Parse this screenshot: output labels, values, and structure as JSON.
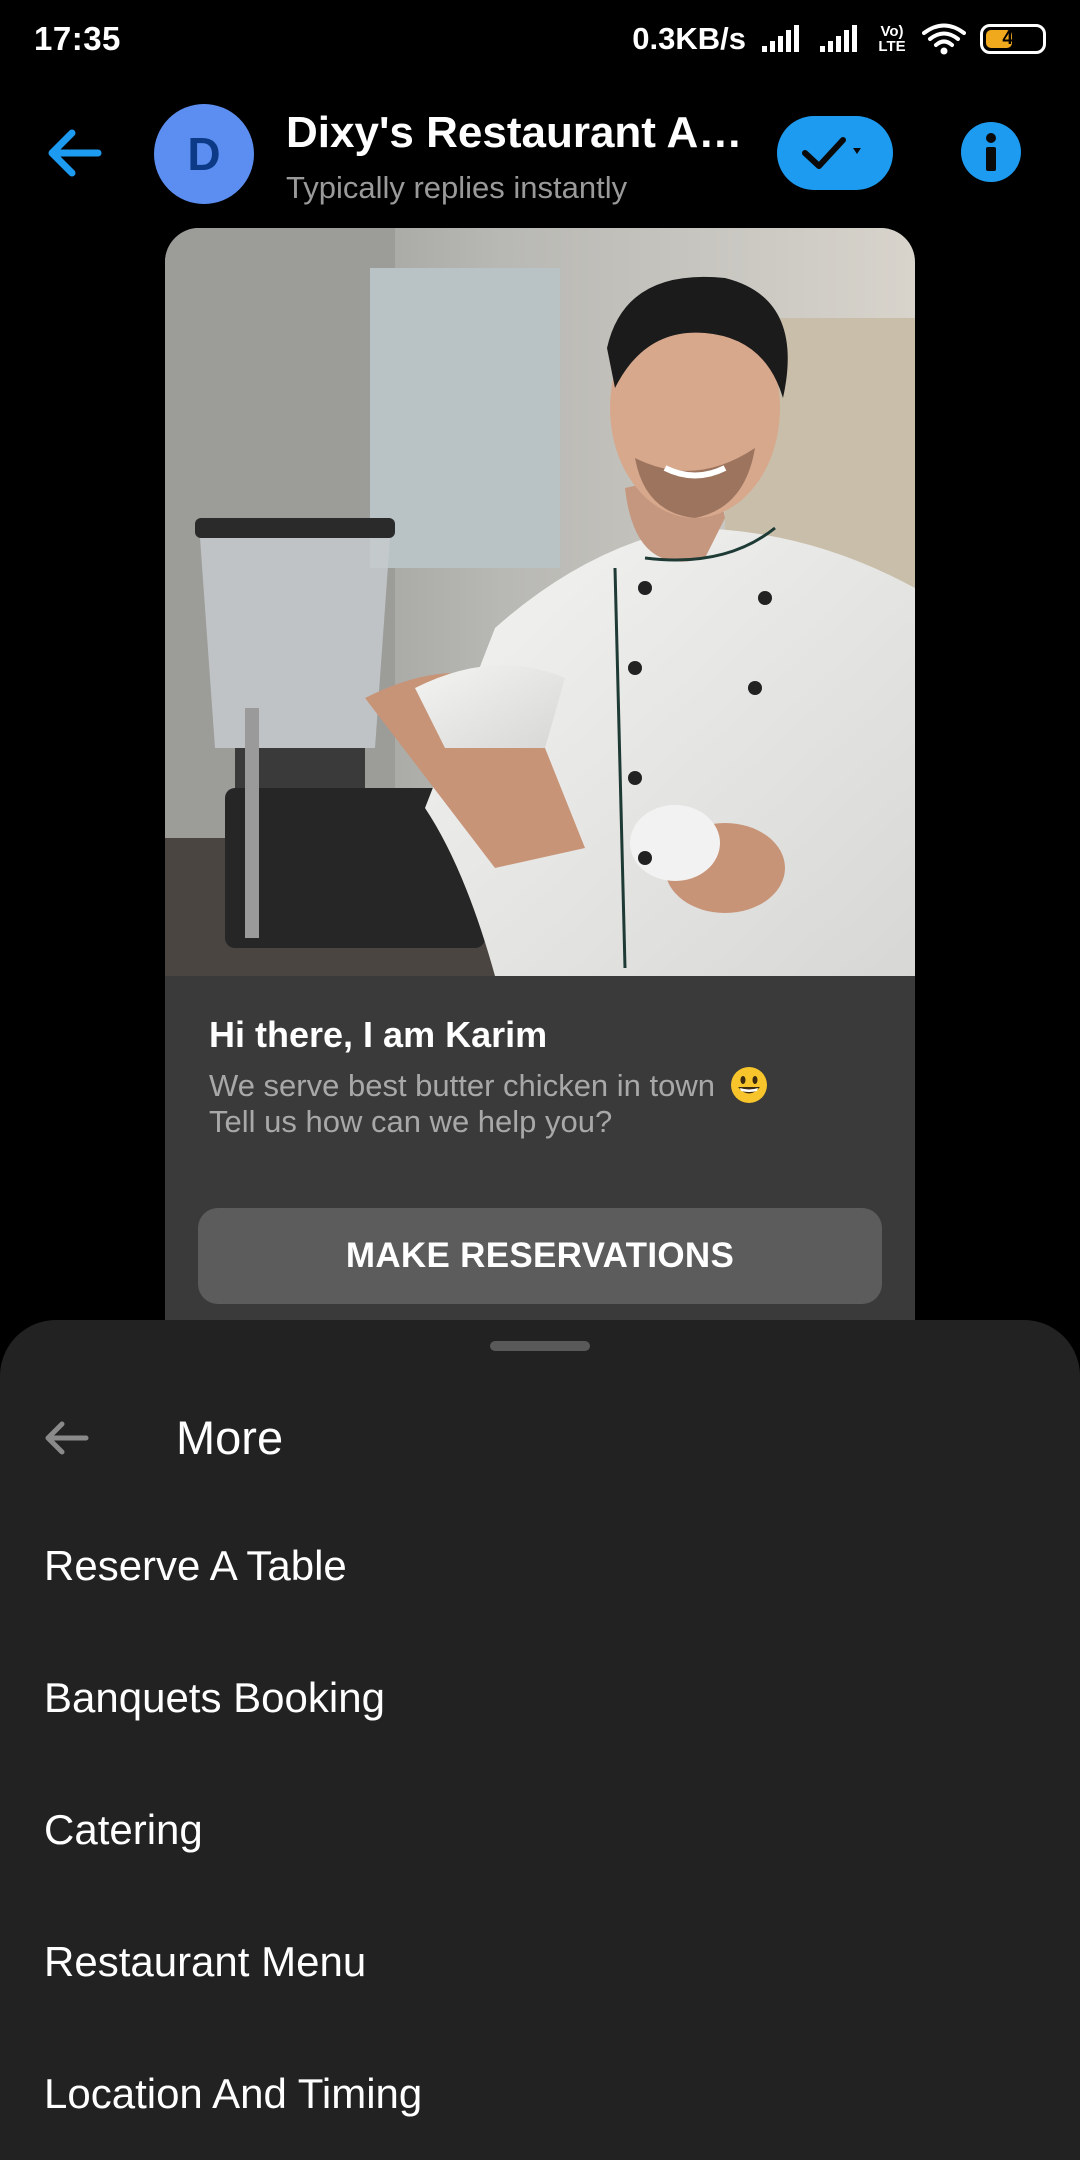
{
  "status_bar": {
    "time": "17:35",
    "network_speed": "0.3KB/s",
    "volte_label": "Vo) LTE",
    "battery_level": "49",
    "battery_fraction": 0.49,
    "battery_color": "#f0a81c"
  },
  "header": {
    "avatar_letter": "D",
    "title": "Dixy's Restaurant And...",
    "subtitle": "Typically replies instantly",
    "accent_color": "#1d9bf0",
    "avatar_color": "#5b8ef0",
    "icons": [
      "back-arrow-icon",
      "checkmark-dropdown-icon",
      "info-icon"
    ]
  },
  "card": {
    "image_description_icon": "chef-photo",
    "title": "Hi there, I am Karim",
    "line1": "We serve best butter chicken in town",
    "line2": "Tell us how can we help you?",
    "emoji_icon": "grinning-face-icon",
    "button_label": "MAKE RESERVATIONS"
  },
  "sheet": {
    "title": "More",
    "items": [
      {
        "label": "Reserve A Table"
      },
      {
        "label": "Banquets Booking"
      },
      {
        "label": "Catering"
      },
      {
        "label": "Restaurant Menu"
      },
      {
        "label": "Location And Timing"
      }
    ]
  }
}
